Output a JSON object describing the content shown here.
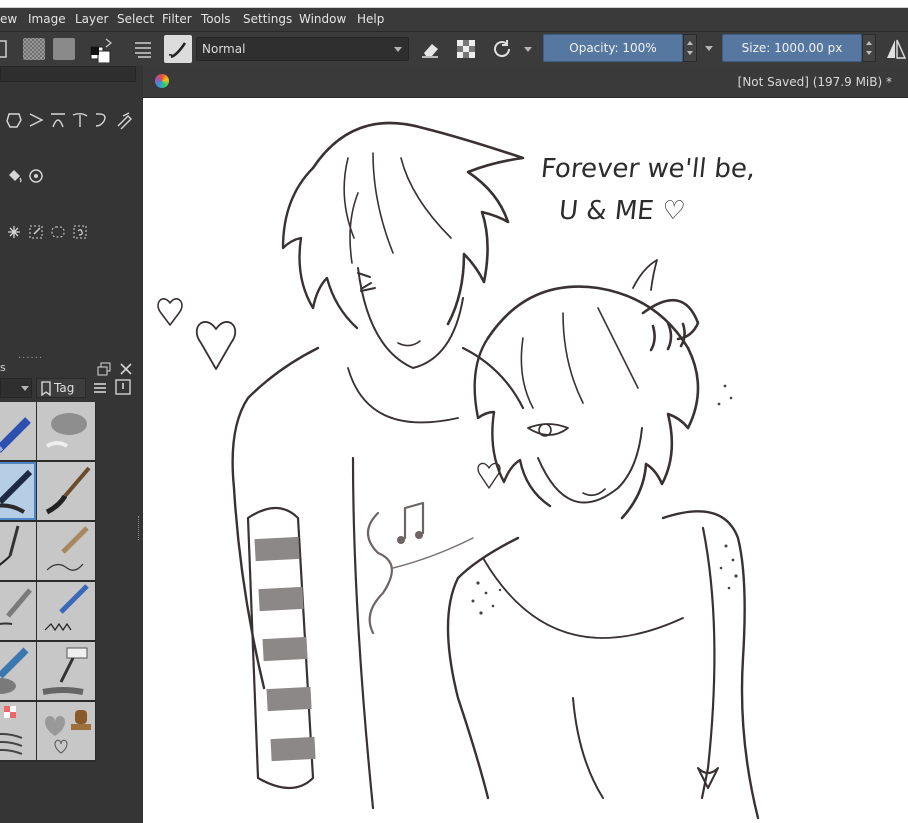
{
  "menu": {
    "items": [
      "ew",
      "Image",
      "Layer",
      "Select",
      "Filter",
      "Tools",
      "Settings",
      "Window",
      "Help"
    ]
  },
  "toolbar": {
    "blend_mode": "Normal",
    "opacity": "Opacity: 100%",
    "size": "Size: 1000.00 px"
  },
  "canvas": {
    "status": "[Not Saved]  (197.9 MiB) *",
    "text_line1": "Forever we'll be,",
    "text_line2": "U & ME ♡"
  },
  "presets": {
    "tag_label": "Tag"
  },
  "colors": {
    "accent": "#5577a0",
    "panel": "#353535",
    "selected_preset": "#b6cde6"
  }
}
